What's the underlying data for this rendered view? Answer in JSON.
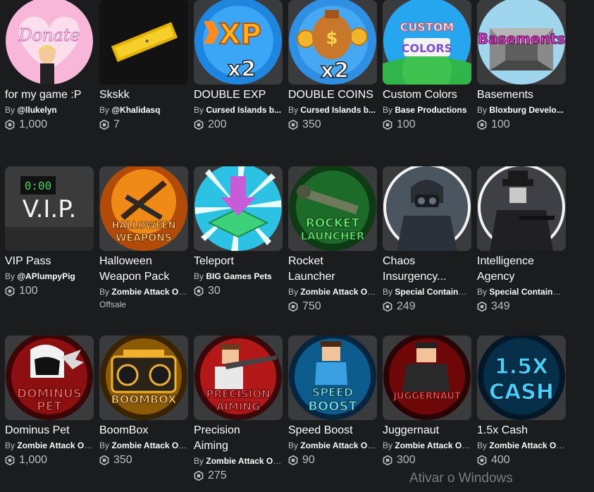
{
  "items": [
    {
      "name": "for my game :P",
      "by_label": "By",
      "creator": "@llukelyn",
      "price": "1,000"
    },
    {
      "name": "Skskk",
      "by_label": "By",
      "creator": "@Khalidasq",
      "price": "7"
    },
    {
      "name": "DOUBLE EXP",
      "by_label": "By",
      "creator": "Cursed Islands b...",
      "price": "200"
    },
    {
      "name": "DOUBLE COINS",
      "by_label": "By",
      "creator": "Cursed Islands b...",
      "price": "350"
    },
    {
      "name": "Custom Colors",
      "by_label": "By",
      "creator": "Base Productions",
      "price": "100"
    },
    {
      "name": "Basements",
      "by_label": "By",
      "creator": "Bloxburg Develo...",
      "price": "100"
    },
    {
      "name": "VIP Pass",
      "by_label": "By",
      "creator": "@APlumpyPig",
      "price": "100"
    },
    {
      "name_line1": "Halloween",
      "name_line2": "Weapon Pack",
      "by_label": "By",
      "creator": "Zombie Attack Of...",
      "status": "Offsale"
    },
    {
      "name": "Teleport",
      "by_label": "By",
      "creator": "BIG Games Pets",
      "price": "30"
    },
    {
      "name_line1": "Rocket",
      "name_line2": "Launcher",
      "by_label": "By",
      "creator": "Zombie Attack Of...",
      "price": "750"
    },
    {
      "name_line1": "Chaos",
      "name_line2": "Insurgency...",
      "by_label": "By",
      "creator": "Special Containm...",
      "price": "249"
    },
    {
      "name_line1": "Intelligence",
      "name_line2": "Agency",
      "by_label": "By",
      "creator": "Special Containm...",
      "price": "349"
    },
    {
      "name": "Dominus Pet",
      "by_label": "By",
      "creator": "Zombie Attack Of...",
      "price": "1,000"
    },
    {
      "name": "BoomBox",
      "by_label": "By",
      "creator": "Zombie Attack Of...",
      "price": "350"
    },
    {
      "name_line1": "Precision",
      "name_line2": "Aiming",
      "by_label": "By",
      "creator": "Zombie Attack Of...",
      "price": "275"
    },
    {
      "name": "Speed Boost",
      "by_label": "By",
      "creator": "Zombie Attack Of...",
      "price": "90"
    },
    {
      "name": "Juggernaut",
      "by_label": "By",
      "creator": "Zombie Attack Of...",
      "price": "300"
    },
    {
      "name": "1.5x Cash",
      "by_label": "By",
      "creator": "Zombie Attack Of...",
      "price": "400"
    }
  ],
  "thumb_text": {
    "donate": "Donate",
    "xp_x2": "x2",
    "xp": "XP",
    "coins_x2": "x2",
    "custom": "CUSTOM",
    "colors": "COLORS",
    "basements": "Basements",
    "timer": "0:00",
    "vip": "V.I.P.",
    "halloween": "HALLOWEEN",
    "weapons": "WEAPONS",
    "rocket": "ROCKET",
    "launcher": "LAUNCHER",
    "dominus": "DOMINUS",
    "pet": "PET",
    "boombox": "BOOMBOX",
    "precision": "PRECISION",
    "aiming": "AIMING",
    "speed": "SPEED",
    "boost": "BOOST",
    "juggernaut": "JUGGERNAUT",
    "cash_15x": "1.5X",
    "cash": "CASH"
  },
  "icons": {
    "currency": "robux-icon"
  },
  "colors": {
    "page_bg": "#1b1c1e",
    "thumb_bg": "#393b3d",
    "muted_text": "#bdbebe"
  },
  "watermark": "Ativar o Windows"
}
